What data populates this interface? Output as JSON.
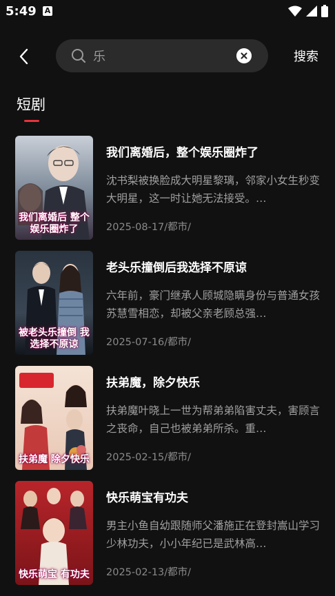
{
  "status": {
    "time": "5:49",
    "badge": "A"
  },
  "header": {
    "back_icon": "back-chevron-icon",
    "search_button": "搜索"
  },
  "search": {
    "query": "乐",
    "icon": "search-icon",
    "clear_icon": "clear-icon"
  },
  "tabs": [
    {
      "label": "短剧",
      "active": true
    }
  ],
  "colors": {
    "background": "#111111",
    "accent": "#e8323c",
    "search_bg": "#2b2b2b"
  },
  "results": [
    {
      "title": "我们离婚后，整个娱乐圈炸了",
      "desc": "沈书梨被换脸成大明星黎璃，邻家小女生秒变大明星，这一时让她无法接受。…",
      "meta": "2025-08-17/都市/",
      "poster_text": "我们离婚后 整个娱乐圈炸了"
    },
    {
      "title": "老头乐撞倒后我选择不原谅",
      "desc": "六年前，豪门继承人顾城隐瞒身份与普通女孩苏慧雪相恋，却被父亲老顾总强…",
      "meta": "2025-07-16/都市/",
      "poster_text": "被老头乐撞倒 我选择不原谅"
    },
    {
      "title": "扶弟魔，除夕快乐",
      "desc": "扶弟魔叶晓上一世为帮弟弟陷害丈夫，害顾言之丧命，自己也被弟弟所杀。重…",
      "meta": "2025-02-15/都市/",
      "poster_text": "扶弟魔 除夕快乐"
    },
    {
      "title": "快乐萌宝有功夫",
      "desc": "男主小鱼自幼跟随师父潘施正在登封嵩山学习少林功夫，小小年纪已是武林高…",
      "meta": "2025-02-13/都市/",
      "poster_text": "快乐萌宝 有功夫"
    }
  ]
}
